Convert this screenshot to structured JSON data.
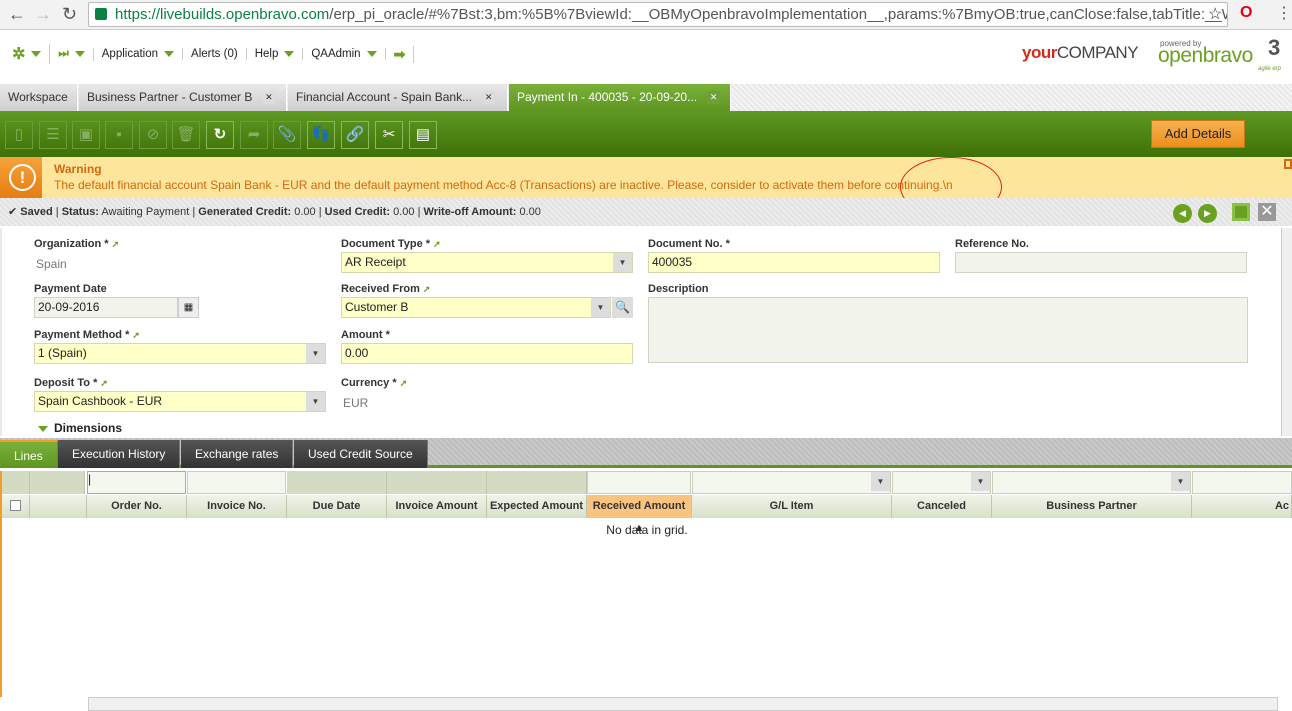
{
  "browser": {
    "url_host": "https://livebuilds.openbravo.com",
    "url_path": "/erp_pi_oracle/#%7Bst:3,bm:%5B%7BviewId:__OBMyOpenbravoImplementation__,params:%7BmyOB:true,canClose:false,tabTitle:__Works"
  },
  "header": {
    "menu": [
      "Application",
      "Alerts (0)",
      "Help",
      "QAAdmin"
    ],
    "company": "yourCOMPANY",
    "company_a": "your",
    "company_b": "COMPANY",
    "powered": "powered by",
    "brand": "openbravo",
    "brand_sub": "agile erp"
  },
  "tabs": [
    {
      "label": "Workspace"
    },
    {
      "label": "Business Partner - Customer B"
    },
    {
      "label": "Financial Account - Spain Bank..."
    },
    {
      "label": "Payment In - 400035 - 20-09-20..."
    }
  ],
  "toolbar": {
    "add_details": "Add Details"
  },
  "warning": {
    "title": "Warning",
    "message": "The default financial account Spain Bank - EUR and the default payment method Acc-8 (Transactions) are inactive. Please, consider to activate them before continuing.\\n"
  },
  "status": {
    "saved": "Saved",
    "status_label": "Status:",
    "status_value": "Awaiting Payment",
    "gen_label": "Generated Credit:",
    "gen_value": "0.00",
    "used_label": "Used Credit:",
    "used_value": "0.00",
    "wo_label": "Write-off Amount:",
    "wo_value": "0.00"
  },
  "form": {
    "organization": {
      "label": "Organization *",
      "value": "Spain"
    },
    "document_type": {
      "label": "Document Type *",
      "value": "AR Receipt"
    },
    "document_no": {
      "label": "Document No. *",
      "value": "400035"
    },
    "reference_no": {
      "label": "Reference No.",
      "value": ""
    },
    "payment_date": {
      "label": "Payment Date",
      "value": "20-09-2016"
    },
    "received_from": {
      "label": "Received From",
      "value": "Customer B"
    },
    "description": {
      "label": "Description",
      "value": ""
    },
    "payment_method": {
      "label": "Payment Method *",
      "value": "1 (Spain)"
    },
    "amount": {
      "label": "Amount *",
      "value": "0.00"
    },
    "deposit_to": {
      "label": "Deposit To *",
      "value": "Spain Cashbook - EUR"
    },
    "currency": {
      "label": "Currency *",
      "value": "EUR"
    },
    "dimensions": "Dimensions"
  },
  "subtabs": [
    "Lines",
    "Execution History",
    "Exchange rates",
    "Used Credit Source"
  ],
  "grid": {
    "columns": [
      "Order No.",
      "Invoice No.",
      "Due Date",
      "Invoice Amount",
      "Expected Amount",
      "Received Amount ▲",
      "G/L Item",
      "Canceled",
      "Business Partner",
      "Ac"
    ],
    "empty": "No data in grid."
  }
}
